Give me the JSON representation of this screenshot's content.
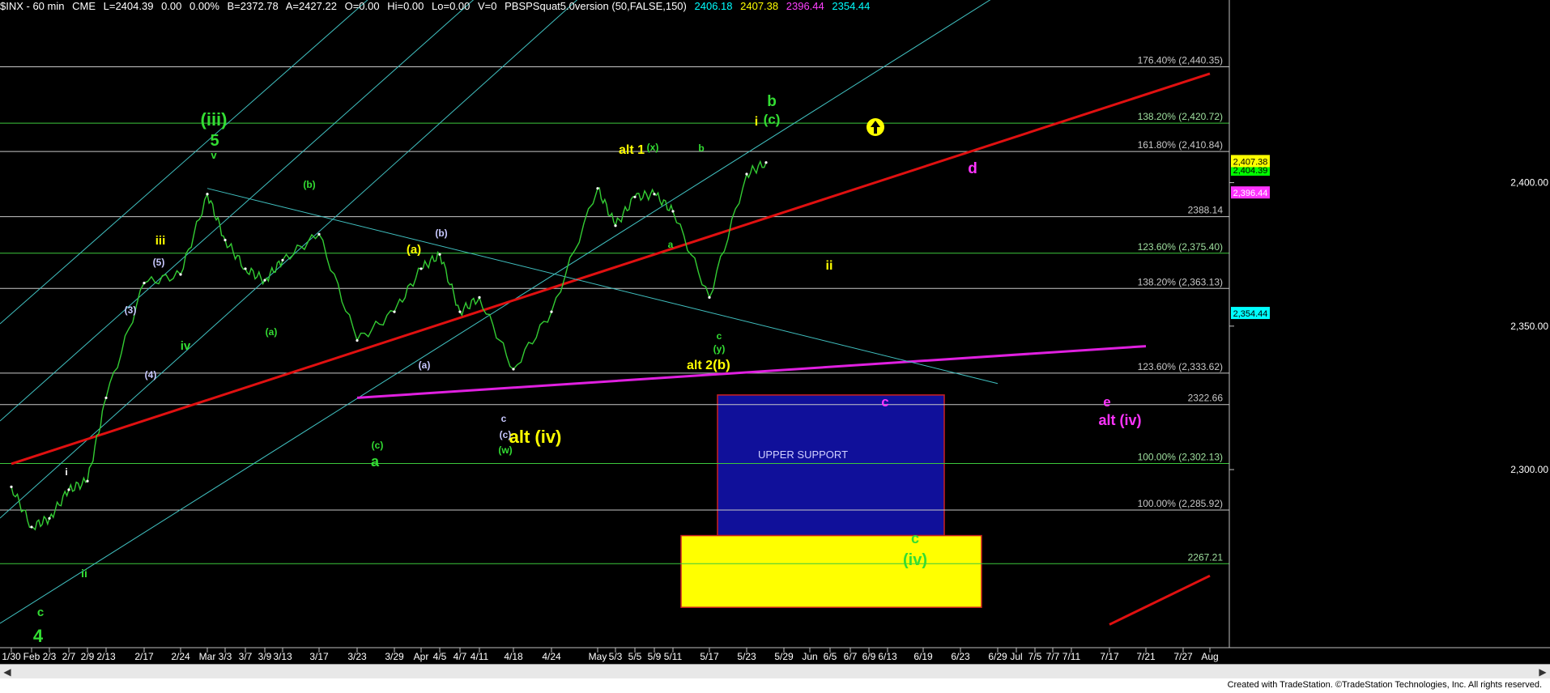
{
  "header": {
    "symbol": "$INX - 60 min",
    "exchange": "CME",
    "last": "L=2404.39",
    "change": "0.00",
    "change_pct": "0.00%",
    "bid": "B=2372.78",
    "ask": "A=2427.22",
    "open": "O=0.00",
    "hi": "Hi=0.00",
    "lo": "Lo=0.00",
    "volume": "V=0",
    "indicator": "PBSPSquat5.0version (50,FALSE,150)",
    "ind_v1": "2406.18",
    "ind_v2": "2407.38",
    "ind_v3": "2396.44",
    "ind_v4": "2354.44"
  },
  "footer": {
    "credit": "Created with TradeStation. ©TradeStation Technologies, Inc. All rights reserved."
  },
  "scrollbar": {
    "left_icon": "arrow-left-icon",
    "right_icon": "arrow-right-icon"
  },
  "colors": {
    "price": "#33cc33",
    "fib_line": "#c8c8c8",
    "fib_green": "#3cc83c",
    "channel": "#40c0c0",
    "red_line": "#e01010",
    "magenta_line": "#e020e0",
    "support_box": "#10109a",
    "yellow_box": "#ffff00",
    "green_label": "#33dd33",
    "yellow_label": "#ffff00",
    "magenta_label": "#ff33ff"
  },
  "chart_data": {
    "type": "line",
    "title": "$INX - 60 min",
    "xlabel": "",
    "ylabel": "",
    "ylim": [
      2245,
      2458
    ],
    "x_tick_labels": [
      "1/30",
      "Feb",
      "2/3",
      "2/7",
      "2/9",
      "2/13",
      "2/17",
      "2/24",
      "Mar",
      "3/3",
      "3/7",
      "3/9",
      "3/13",
      "3/17",
      "3/23",
      "3/29",
      "Apr",
      "4/5",
      "4/7",
      "4/11",
      "4/18",
      "4/24",
      "May",
      "5/3",
      "5/5",
      "5/9",
      "5/11",
      "5/17",
      "5/23",
      "5/29",
      "Jun",
      "6/5",
      "6/7",
      "6/9",
      "6/13",
      "6/19",
      "6/23",
      "6/29",
      "Jul",
      "7/5",
      "7/7",
      "7/11",
      "7/17",
      "7/21",
      "7/27",
      "Aug"
    ],
    "y_tick_labels": [
      "2,400.00",
      "2,350.00",
      "2,300.00"
    ],
    "price_tags": [
      {
        "label": "2,404.39",
        "value": 2404.39,
        "color": "#00ff00"
      },
      {
        "label": "2,407.38",
        "value": 2407.38,
        "color": "#ffff00"
      },
      {
        "label": "2,396.44",
        "value": 2396.44,
        "color": "#ff33ff"
      },
      {
        "label": "2,354.44",
        "value": 2354.44,
        "color": "#00ffff"
      }
    ],
    "price_series": {
      "name": "$INX",
      "points": [
        [
          "1/30",
          2294
        ],
        [
          "Feb",
          2280
        ],
        [
          "2/3",
          2283
        ],
        [
          "2/7",
          2293
        ],
        [
          "2/9",
          2296
        ],
        [
          "2/13",
          2325
        ],
        [
          "2/17",
          2365
        ],
        [
          "2/24",
          2368
        ],
        [
          "Mar",
          2396
        ],
        [
          "3/3",
          2380
        ],
        [
          "3/7",
          2370
        ],
        [
          "3/9",
          2366
        ],
        [
          "3/13",
          2373
        ],
        [
          "3/17",
          2382
        ],
        [
          "3/23",
          2345
        ],
        [
          "3/29",
          2355
        ],
        [
          "Apr",
          2370
        ],
        [
          "4/5",
          2375
        ],
        [
          "4/7",
          2355
        ],
        [
          "4/11",
          2360
        ],
        [
          "4/18",
          2335
        ],
        [
          "4/24",
          2355
        ],
        [
          "May",
          2398
        ],
        [
          "5/3",
          2385
        ],
        [
          "5/5",
          2395
        ],
        [
          "5/9",
          2396
        ],
        [
          "5/11",
          2390
        ],
        [
          "5/17",
          2360
        ],
        [
          "5/23",
          2403
        ],
        [
          "5/23",
          2407
        ]
      ]
    },
    "fib_levels": [
      {
        "label": "176.40% (2,440.35)",
        "value": 2440.35,
        "color": "#c8c8c8"
      },
      {
        "label": "138.20% (2,420.72)",
        "value": 2420.72,
        "color": "#3cc83c"
      },
      {
        "label": "161.80% (2,410.84)",
        "value": 2410.84,
        "color": "#c8c8c8"
      },
      {
        "label": "2388.14",
        "value": 2388.14,
        "color": "#c8c8c8"
      },
      {
        "label": "123.60% (2,375.40)",
        "value": 2375.4,
        "color": "#3cc83c"
      },
      {
        "label": "138.20% (2,363.13)",
        "value": 2363.13,
        "color": "#c8c8c8"
      },
      {
        "label": "123.60% (2,333.62)",
        "value": 2333.62,
        "color": "#c8c8c8"
      },
      {
        "label": "2322.66",
        "value": 2322.66,
        "color": "#c8c8c8"
      },
      {
        "label": "100.00% (2,302.13)",
        "value": 2302.13,
        "color": "#3cc83c"
      },
      {
        "label": "100.00% (2,285.92)",
        "value": 2285.92,
        "color": "#c8c8c8"
      },
      {
        "label": "2267.21",
        "value": 2267.21,
        "color": "#3cc83c"
      }
    ],
    "trend_lines": [
      {
        "name": "red-trendline",
        "color": "#e01010",
        "from": [
          "1/30",
          2302
        ],
        "to": [
          "Aug",
          2438
        ]
      },
      {
        "name": "red-trendline-lower",
        "color": "#e01010",
        "from": [
          "7/17",
          2246
        ],
        "to": [
          "Aug",
          2263
        ]
      },
      {
        "name": "magenta-trendline",
        "color": "#e020e0",
        "from": [
          "3/23",
          2325
        ],
        "to": [
          "7/21",
          2343
        ]
      },
      {
        "name": "downtrend-channel-line",
        "color": "#40c0c0",
        "from": [
          "Mar",
          2398
        ],
        "to": [
          "6/29",
          2330
        ]
      }
    ],
    "zones": [
      {
        "name": "upper-support-zone",
        "label": "UPPER SUPPORT",
        "color": "#10109a",
        "x_from": "5/17",
        "x_to": "6/23",
        "y_from": 2277,
        "y_to": 2326
      },
      {
        "name": "yellow-support-zone",
        "label": "",
        "color": "#ffff00",
        "x_from": "5/11",
        "x_to": "6/29",
        "y_from": 2252,
        "y_to": 2277
      }
    ],
    "wave_labels": [
      {
        "text": "(iii)",
        "color": "#33dd33"
      },
      {
        "text": "5",
        "color": "#33dd33"
      },
      {
        "text": "v",
        "color": "#33dd33"
      },
      {
        "text": "iii",
        "color": "#ffff00"
      },
      {
        "text": "iv",
        "color": "#33dd33"
      },
      {
        "text": "ii",
        "color": "#33dd33"
      },
      {
        "text": "c",
        "color": "#33dd33"
      },
      {
        "text": "4",
        "color": "#33dd33"
      },
      {
        "text": "i",
        "color": "#ffffff"
      },
      {
        "text": "(3)",
        "color": "#c8c8ff"
      },
      {
        "text": "(4)",
        "color": "#c8c8ff"
      },
      {
        "text": "(5)",
        "color": "#c8c8ff"
      },
      {
        "text": "(b)",
        "color": "#33dd33"
      },
      {
        "text": "(a)",
        "color": "#33dd33"
      },
      {
        "text": "(c)",
        "color": "#33dd33"
      },
      {
        "text": "a",
        "color": "#33dd33"
      },
      {
        "text": "(a)",
        "color": "#ffff00"
      },
      {
        "text": "(b)",
        "color": "#c8c8ff"
      },
      {
        "text": "(a)",
        "color": "#c8c8ff"
      },
      {
        "text": "c",
        "color": "#c8c8ff"
      },
      {
        "text": "(c)",
        "color": "#c8c8ff"
      },
      {
        "text": "(w)",
        "color": "#33dd33"
      },
      {
        "text": "alt (iv)",
        "color": "#ffff00"
      },
      {
        "text": "alt 1",
        "color": "#ffff00"
      },
      {
        "text": "(x)",
        "color": "#33dd33"
      },
      {
        "text": "a",
        "color": "#33dd33"
      },
      {
        "text": "b",
        "color": "#33dd33"
      },
      {
        "text": "alt 2",
        "color": "#ffff00"
      },
      {
        "text": "(b)",
        "color": "#ffff00"
      },
      {
        "text": "c",
        "color": "#33dd33"
      },
      {
        "text": "(y)",
        "color": "#33dd33"
      },
      {
        "text": "b",
        "color": "#33dd33"
      },
      {
        "text": "(c)",
        "color": "#33dd33"
      },
      {
        "text": "i",
        "color": "#ffff00"
      },
      {
        "text": "ii",
        "color": "#ffff00"
      },
      {
        "text": "d",
        "color": "#ff33ff"
      },
      {
        "text": "c",
        "color": "#ff33ff"
      },
      {
        "text": "e",
        "color": "#ff33ff"
      },
      {
        "text": "alt (iv)",
        "color": "#ff33ff"
      },
      {
        "text": "c",
        "color": "#33dd33"
      },
      {
        "text": "(iv)",
        "color": "#33dd33"
      }
    ]
  }
}
